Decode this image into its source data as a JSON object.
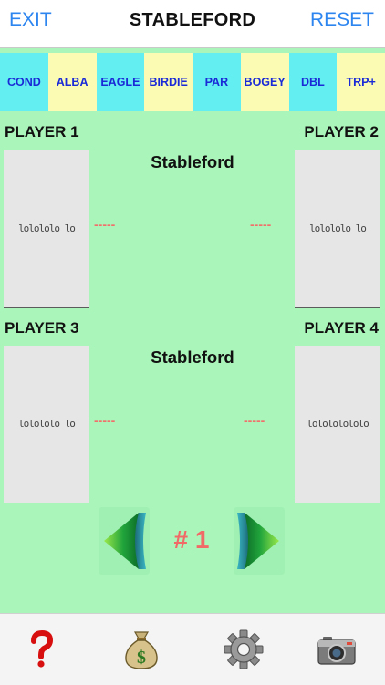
{
  "header": {
    "exit_label": "EXIT",
    "title": "STABLEFORD",
    "reset_label": "RESET"
  },
  "categories": [
    {
      "label": "COND",
      "color": "#63eef2"
    },
    {
      "label": "ALBA",
      "color": "#fbfbb4"
    },
    {
      "label": "EAGLE",
      "color": "#63eef2"
    },
    {
      "label": "BIRDIE",
      "color": "#fbfbb4"
    },
    {
      "label": "PAR",
      "color": "#63eef2"
    },
    {
      "label": "BOGEY",
      "color": "#fbfbb4"
    },
    {
      "label": "DBL",
      "color": "#63eef2"
    },
    {
      "label": "TRP+",
      "color": "#fbfbb4"
    }
  ],
  "players": [
    {
      "name": "PLAYER 1",
      "signature": "lolololo lo",
      "score": "-----"
    },
    {
      "name": "PLAYER 2",
      "signature": "lolololo lo",
      "score": "-----"
    },
    {
      "name": "PLAYER 3",
      "signature": "lolololo lo",
      "score": "-----"
    },
    {
      "name": "PLAYER 4",
      "signature": "lolololololo",
      "score": "-----"
    }
  ],
  "game_labels": [
    "Stableford",
    "Stableford"
  ],
  "hole": {
    "label": "# 1"
  },
  "toolbar": {
    "icons": [
      "help-icon",
      "money-bag-icon",
      "settings-gear-icon",
      "camera-icon"
    ]
  },
  "colors": {
    "background": "#aaf5b9",
    "accent_blue": "#2d86f0",
    "category_text": "#1a2ad6",
    "hole_number": "#f26a68",
    "dash": "#f2706c"
  }
}
